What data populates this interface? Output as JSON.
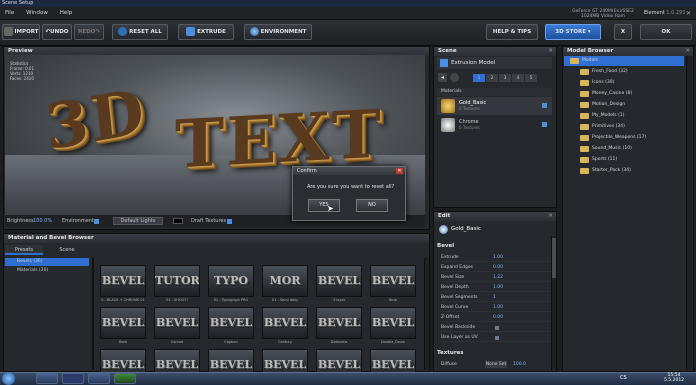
{
  "window": {
    "title": "Scene Setup"
  },
  "menu": [
    "File",
    "Window",
    "Help"
  ],
  "hardware": {
    "gpu": "GeForce GT 240M(Ex)/SSE2",
    "memory": "1024MB Video Ram",
    "product": "Element",
    "version": "1.0.793"
  },
  "toolbar": {
    "import": "IMPORT",
    "undo": "UNDO",
    "redo": "REDO",
    "reset": "RESET ALL",
    "extrude": "EXTRUDE",
    "environment": "ENVIRONMENT",
    "help": "HELP & TIPS",
    "store": "3D STORE",
    "close": "X",
    "ok": "OK"
  },
  "preview": {
    "title": "Preview",
    "text1": "3D",
    "text2": "TEXT",
    "stats": [
      "Statistics",
      "Frame: 0.01",
      "Verts: 1210",
      "Faces: 2420"
    ],
    "bar": {
      "brightness_label": "Brightness",
      "brightness": "100.0%",
      "env_label": "Environment",
      "lights_label": "Default Lights",
      "draft_label": "Draft Textures"
    }
  },
  "dialog": {
    "title": "Confirm",
    "message": "Are you sure you want to reset all?",
    "yes": "YES",
    "no": "NO"
  },
  "scene": {
    "title": "Scene",
    "group": "Extrusion Model",
    "tabs": [
      "1",
      "2",
      "3",
      "4",
      "5"
    ],
    "section": "Materials",
    "materials": [
      {
        "name": "Gold_Basic",
        "sub": "0 Textures",
        "color": "#d9a83a"
      },
      {
        "name": "Chrome",
        "sub": "0 Textures",
        "color": "#c8ccd2"
      }
    ]
  },
  "edit": {
    "title": "Edit",
    "material": "Gold_Basic",
    "section": "Bevel",
    "section2": "Textures",
    "props": [
      {
        "k": "Extrude",
        "v": "1.00"
      },
      {
        "k": "Expand Edges",
        "v": "0.00"
      },
      {
        "k": "Bevel Size",
        "v": "1.22"
      },
      {
        "k": "Bevel Depth",
        "v": "1.00"
      },
      {
        "k": "Bevel Segments",
        "v": "1"
      },
      {
        "k": "Bevel Curve",
        "v": "1.00"
      },
      {
        "k": "Z-Offset",
        "v": "0.00"
      },
      {
        "k": "Bevel Backside",
        "v": ""
      },
      {
        "k": "Use Layer as UV",
        "v": ""
      }
    ],
    "diffuse_label": "Diffuse",
    "diffuse_value": "None Set",
    "diffuse_num": "100.0"
  },
  "model_browser": {
    "title": "Model Browser",
    "items": [
      "Models",
      "Fresh_Food (32)",
      "Icons (30)",
      "Money_Casino (8)",
      "Motion_Design",
      "My_Models (1)",
      "Primitives (34)",
      "Projectile_Weapons (17)",
      "Sound_Music (10)",
      "Sports (11)",
      "Starter_Pack (34)"
    ]
  },
  "material_browser": {
    "title": "Material and Bevel Browser",
    "tabs": [
      "Presets",
      "Scene"
    ],
    "tree": [
      "Bevels (36)",
      "Materials (20)"
    ],
    "tiles": [
      {
        "label": "0 - BLACK + CHROME 01",
        "text": "BEVEL"
      },
      {
        "label": "01 - SHOOT!",
        "text": "TUTORIAL"
      },
      {
        "label": "01 - Typograph PRO",
        "text": "TYPO"
      },
      {
        "label": "01 - Semi daily",
        "text": "MOR"
      },
      {
        "label": "3 layer",
        "text": "BEVEL"
      },
      {
        "label": "Blue",
        "text": "BEVEL"
      },
      {
        "label": "Bold",
        "text": "BEVEL"
      },
      {
        "label": "Carved",
        "text": "BEVEL"
      },
      {
        "label": "Caption",
        "text": "BEVEL"
      },
      {
        "label": "Century",
        "text": "BEVEL"
      },
      {
        "label": "Dataview",
        "text": "BEVEL"
      },
      {
        "label": "Double_Down",
        "text": "BEVEL"
      },
      {
        "label": "",
        "text": "BEVEL"
      },
      {
        "label": "",
        "text": "BEVEL"
      },
      {
        "label": "",
        "text": "BEVEL"
      },
      {
        "label": "",
        "text": "BEVEL"
      },
      {
        "label": "",
        "text": "BEVEL"
      },
      {
        "label": "",
        "text": "BEVEL"
      }
    ]
  },
  "taskbar": {
    "lang": "CS",
    "time": "15:54",
    "date": "5.5.2012"
  },
  "colors": {
    "accent": "#2f6fd1",
    "gold": "#d9a83a",
    "bg": "#1b1d20"
  }
}
